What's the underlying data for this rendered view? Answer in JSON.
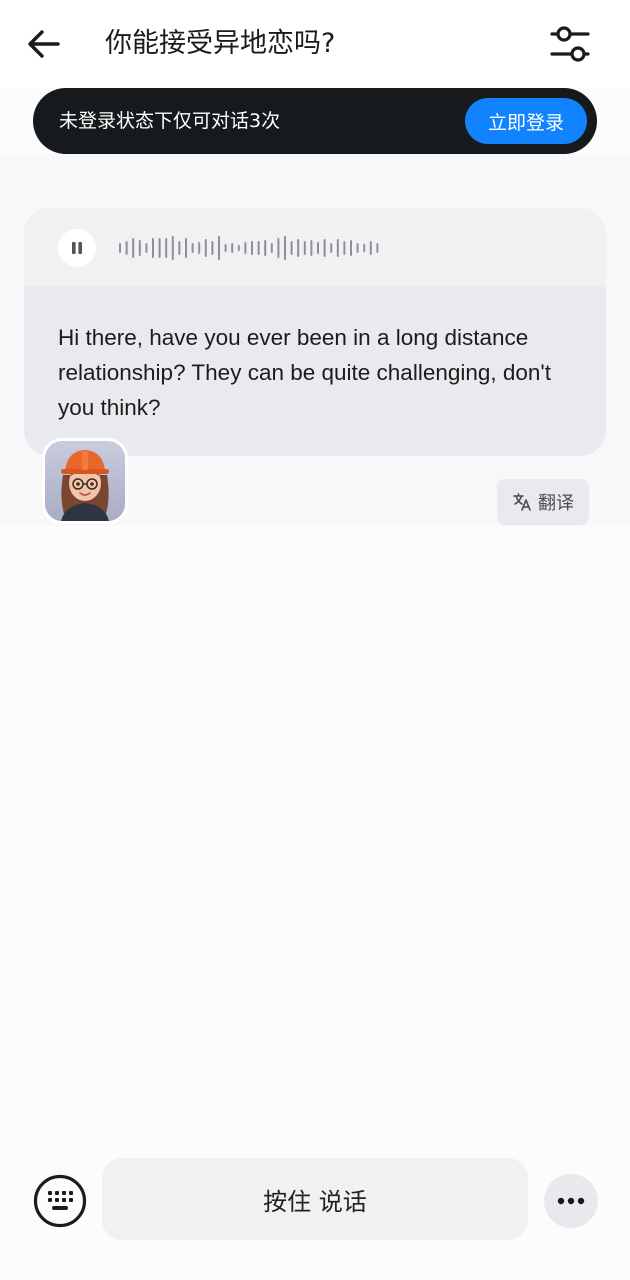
{
  "header": {
    "title": "你能接受异地恋吗?",
    "back_icon": "arrow-left-icon",
    "settings_icon": "sliders-icon"
  },
  "login_banner": {
    "text": "未登录状态下仅可对话3次",
    "button_label": "立即登录",
    "button_color": "#1283ff",
    "banner_color": "#161a1d"
  },
  "message": {
    "audio_state_icon": "pause-icon",
    "waveform_icon": "waveform-icon",
    "text": "Hi there, have you ever been in a long distance relationship? They can be quite challenging, don't you think?",
    "avatar_icon": "avatar-girl-hardhat",
    "translate_label": "翻译",
    "translate_icon": "translate-icon"
  },
  "input_bar": {
    "keyboard_icon": "keyboard-icon",
    "hold_to_talk_label": "按住 说话",
    "more_icon": "more-dots-icon"
  }
}
